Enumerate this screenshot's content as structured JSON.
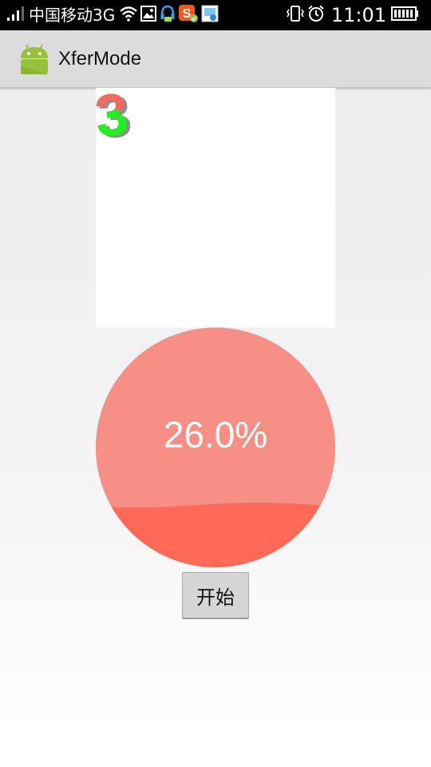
{
  "status_bar": {
    "carrier": "中国移动3G",
    "time": "11:01",
    "icons": [
      "signal-icon",
      "wifi-icon",
      "gallery-icon",
      "headset-icon",
      "sogou-input-icon",
      "screenshot-icon",
      "vibrate-icon",
      "alarm-icon",
      "battery-icon"
    ]
  },
  "action_bar": {
    "app_icon": "android-robot-icon",
    "title": "XferMode"
  },
  "canvas": {
    "digit": "3",
    "colors": {
      "top": "#f26a63",
      "bottom": "#22ee22",
      "shadow": "#333333"
    }
  },
  "progress": {
    "percent_text": "26.0%",
    "fill_fraction": 0.26,
    "colors": {
      "background": "#f88f87",
      "wave": "#ff6a58"
    }
  },
  "start_button": {
    "label": "开始"
  }
}
